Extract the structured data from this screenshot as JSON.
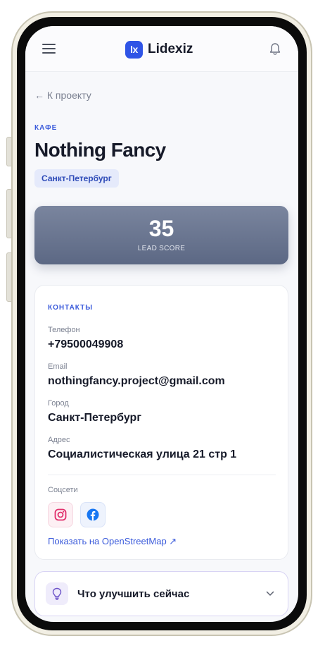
{
  "header": {
    "logo_mark": "lx",
    "logo_text": "Lidexiz",
    "menu_icon": "hamburger-icon",
    "notification_icon": "bell-icon"
  },
  "nav": {
    "back_label": "← К проекту"
  },
  "business": {
    "category": "КАФЕ",
    "name": "Nothing Fancy",
    "city_badge": "Санкт-Петербург"
  },
  "lead_score": {
    "value": "35",
    "label": "LEAD SCORE"
  },
  "contacts": {
    "title": "КОНТАКТЫ",
    "fields": [
      {
        "label": "Телефон",
        "value": "+79500049908"
      },
      {
        "label": "Email",
        "value": "nothingfancy.project@gmail.com"
      },
      {
        "label": "Город",
        "value": "Санкт-Петербург"
      },
      {
        "label": "Адрес",
        "value": "Социалистическая улица 21 стр 1"
      }
    ],
    "socials_label": "Соцсети",
    "socials": [
      {
        "icon": "instagram-icon",
        "color": "#e1306c"
      },
      {
        "icon": "facebook-icon",
        "color": "#1877f2"
      }
    ],
    "map_link": "Показать на OpenStreetMap ↗"
  },
  "improve": {
    "label": "Что улучшить сейчас",
    "icon": "lightbulb-icon"
  },
  "colors": {
    "accent": "#3b5bdb",
    "brand": "#2f54e6",
    "score_card": "#66718c"
  }
}
